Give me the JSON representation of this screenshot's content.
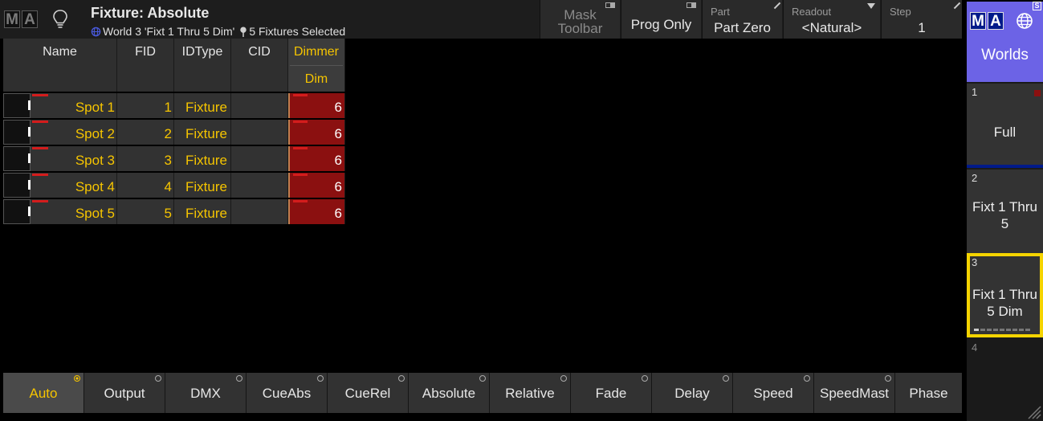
{
  "app": {
    "logo": [
      "M",
      "A"
    ]
  },
  "title": {
    "text": "Fixture: Absolute",
    "world_label": "World 3 'Fixt 1 Thru 5 Dim'",
    "selection_label": "5 Fixtures Selected"
  },
  "toolbar": {
    "mask": {
      "line1": "Mask",
      "line2": "Toolbar"
    },
    "prog_only": "Prog Only",
    "part": {
      "label": "Part",
      "value": "Part Zero"
    },
    "readout": {
      "label": "Readout",
      "value": "<Natural>"
    },
    "step": {
      "label": "Step",
      "value": "1"
    }
  },
  "sheet": {
    "columns": {
      "name": "Name",
      "fid": "FID",
      "idtype": "IDType",
      "cid": "CID",
      "dimmer": "Dimmer",
      "dimmer_sub": "Dim"
    },
    "rows": [
      {
        "name": "Spot 1",
        "fid": "1",
        "idtype": "Fixture",
        "cid": "",
        "dim": "6"
      },
      {
        "name": "Spot 2",
        "fid": "2",
        "idtype": "Fixture",
        "cid": "",
        "dim": "6"
      },
      {
        "name": "Spot 3",
        "fid": "3",
        "idtype": "Fixture",
        "cid": "",
        "dim": "6"
      },
      {
        "name": "Spot 4",
        "fid": "4",
        "idtype": "Fixture",
        "cid": "",
        "dim": "6"
      },
      {
        "name": "Spot 5",
        "fid": "5",
        "idtype": "Fixture",
        "cid": "",
        "dim": "6"
      }
    ]
  },
  "encoder_tabs": [
    "Auto",
    "Output",
    "DMX",
    "CueAbs",
    "CueRel",
    "Absolute",
    "Relative",
    "Fade",
    "Delay",
    "Speed",
    "SpeedMast",
    "Phase"
  ],
  "active_tab": "Auto",
  "worlds": {
    "logo": [
      "M",
      "A"
    ],
    "badge": "S",
    "title": "Worlds",
    "items": [
      {
        "num": "1",
        "label": "Full"
      },
      {
        "num": "2",
        "label": "Fixt 1 Thru 5"
      },
      {
        "num": "3",
        "label": "Fixt 1 Thru 5 Dim",
        "selected": true
      },
      {
        "num": "4",
        "label": ""
      }
    ]
  },
  "colors": {
    "accent_yellow": "#f5c400",
    "dimmer_red": "#8b1010",
    "worlds_header": "#6c63e6",
    "dark_blue": "#001a8a"
  }
}
